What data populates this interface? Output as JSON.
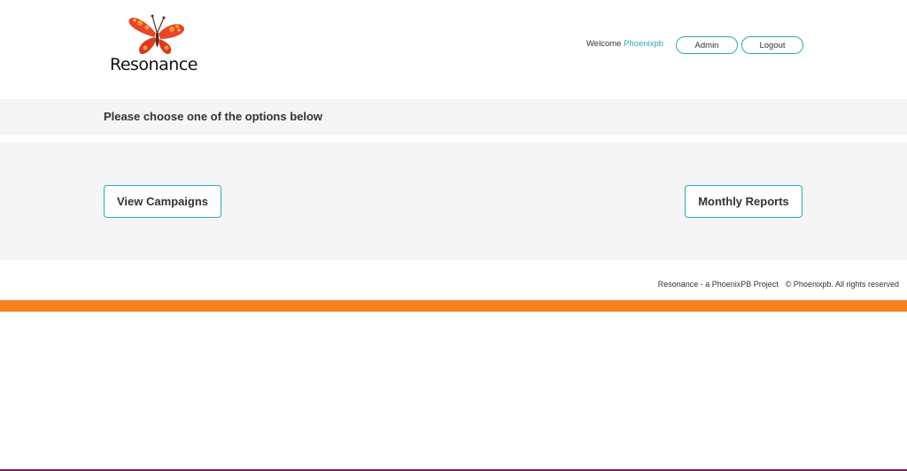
{
  "brand": {
    "logo_text": "Resonance",
    "accent_color": "#2aaab3",
    "orange_color": "#f5821f"
  },
  "header": {
    "welcome_label": "Welcome",
    "username": "Phoenixpb",
    "admin_label": "Admin",
    "logout_label": "Logout"
  },
  "main": {
    "prompt": "Please choose one of the options below",
    "options": [
      {
        "label": "View Campaigns"
      },
      {
        "label": "Monthly Reports"
      }
    ]
  },
  "footer": {
    "project": "Resonance - a PhoenixPB Project",
    "copyright": "© Phoenixpb. All rights reserved"
  }
}
